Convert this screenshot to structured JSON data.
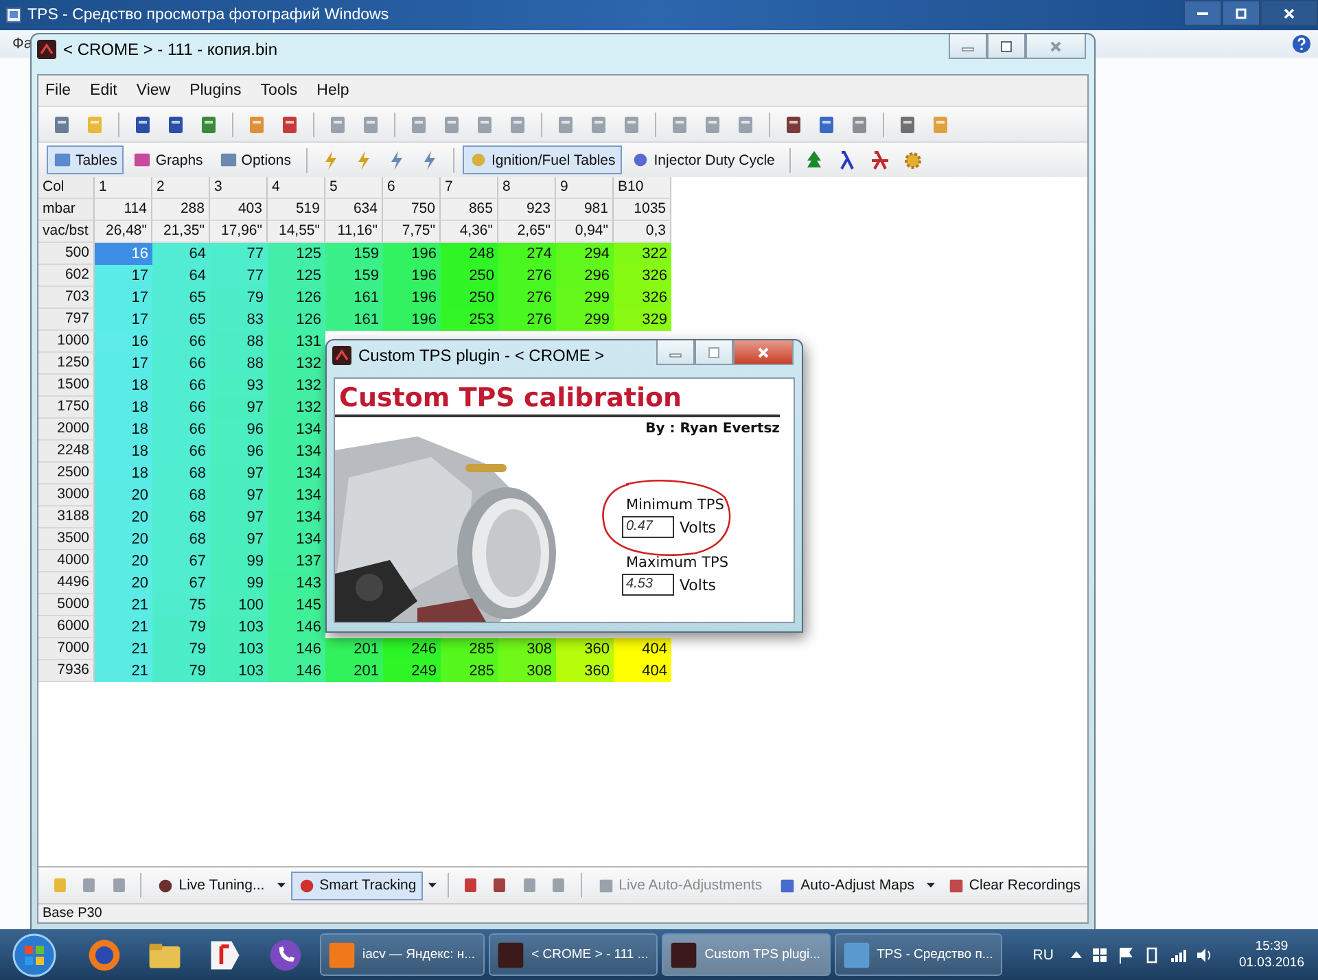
{
  "background_window": {
    "title": "TPS - Средство просмотра фотографий Windows",
    "menu_fragment": "Фа"
  },
  "main_window": {
    "title": "< CROME > - 111 - копия.bin",
    "menu": [
      "File",
      "Edit",
      "View",
      "Plugins",
      "Tools",
      "Help"
    ],
    "toolbar_buttons": [
      {
        "label": "Tables",
        "selected": true
      },
      {
        "label": "Graphs",
        "selected": false
      },
      {
        "label": "Options",
        "selected": false
      },
      {
        "label": "Ignition/Fuel Tables",
        "selected": true
      },
      {
        "label": "Injector Duty Cycle",
        "selected": false
      }
    ],
    "table": {
      "header_rows": [
        {
          "label": "Col",
          "cells": [
            "1",
            "2",
            "3",
            "4",
            "5",
            "6",
            "7",
            "8",
            "9",
            "B10"
          ]
        },
        {
          "label": "mbar",
          "cells": [
            "114",
            "288",
            "403",
            "519",
            "634",
            "750",
            "865",
            "923",
            "981",
            "1035"
          ]
        },
        {
          "label": "vac/bst",
          "cells": [
            "26,48\"",
            "21,35\"",
            "17,96\"",
            "14,55\"",
            "11,16\"",
            "7,75\"",
            "4,36\"",
            "2,65\"",
            "0,94\"",
            "0,3"
          ]
        }
      ],
      "rows": [
        {
          "label": "500",
          "cells": [
            {
              "value": "16",
              "selected": true
            },
            {
              "value": "64",
              "selected": false
            },
            {
              "value": "77",
              "selected": false
            },
            {
              "value": "125",
              "selected": false
            },
            {
              "value": "159",
              "selected": false
            },
            {
              "value": "196",
              "selected": false
            },
            {
              "value": "248",
              "selected": false
            },
            {
              "value": "274",
              "selected": false
            },
            {
              "value": "294",
              "selected": false
            },
            {
              "value": "322",
              "selected": false
            }
          ]
        },
        {
          "label": "602",
          "cells": [
            {
              "value": "17",
              "selected": false
            },
            {
              "value": "64",
              "selected": false
            },
            {
              "value": "77",
              "selected": false
            },
            {
              "value": "125",
              "selected": false
            },
            {
              "value": "159",
              "selected": false
            },
            {
              "value": "196",
              "selected": false
            },
            {
              "value": "250",
              "selected": false
            },
            {
              "value": "276",
              "selected": false
            },
            {
              "value": "296",
              "selected": false
            },
            {
              "value": "326",
              "selected": false
            }
          ]
        },
        {
          "label": "703",
          "cells": [
            {
              "value": "17",
              "selected": false
            },
            {
              "value": "65",
              "selected": false
            },
            {
              "value": "79",
              "selected": false
            },
            {
              "value": "126",
              "selected": false
            },
            {
              "value": "161",
              "selected": false
            },
            {
              "value": "196",
              "selected": false
            },
            {
              "value": "250",
              "selected": false
            },
            {
              "value": "276",
              "selected": false
            },
            {
              "value": "299",
              "selected": false
            },
            {
              "value": "326",
              "selected": false
            }
          ]
        },
        {
          "label": "797",
          "cells": [
            {
              "value": "17",
              "selected": false
            },
            {
              "value": "65",
              "selected": false
            },
            {
              "value": "83",
              "selected": false
            },
            {
              "value": "126",
              "selected": false
            },
            {
              "value": "161",
              "selected": false
            },
            {
              "value": "196",
              "selected": false
            },
            {
              "value": "253",
              "selected": false
            },
            {
              "value": "276",
              "selected": false
            },
            {
              "value": "299",
              "selected": false
            },
            {
              "value": "329",
              "selected": false
            }
          ]
        },
        {
          "label": "1000",
          "cells": [
            {
              "value": "16",
              "selected": false
            },
            {
              "value": "66",
              "selected": false
            },
            {
              "value": "88",
              "selected": false
            },
            {
              "value": "131",
              "selected": false
            }
          ]
        },
        {
          "label": "1250",
          "cells": [
            {
              "value": "17",
              "selected": false
            },
            {
              "value": "66",
              "selected": false
            },
            {
              "value": "88",
              "selected": false
            },
            {
              "value": "132",
              "selected": false
            }
          ]
        },
        {
          "label": "1500",
          "cells": [
            {
              "value": "18",
              "selected": false
            },
            {
              "value": "66",
              "selected": false
            },
            {
              "value": "93",
              "selected": false
            },
            {
              "value": "132",
              "selected": false
            }
          ]
        },
        {
          "label": "1750",
          "cells": [
            {
              "value": "18",
              "selected": false
            },
            {
              "value": "66",
              "selected": false
            },
            {
              "value": "97",
              "selected": false
            },
            {
              "value": "132",
              "selected": false
            }
          ]
        },
        {
          "label": "2000",
          "cells": [
            {
              "value": "18",
              "selected": false
            },
            {
              "value": "66",
              "selected": false
            },
            {
              "value": "96",
              "selected": false
            },
            {
              "value": "134",
              "selected": false
            }
          ]
        },
        {
          "label": "2248",
          "cells": [
            {
              "value": "18",
              "selected": false
            },
            {
              "value": "66",
              "selected": false
            },
            {
              "value": "96",
              "selected": false
            },
            {
              "value": "134",
              "selected": false
            }
          ]
        },
        {
          "label": "2500",
          "cells": [
            {
              "value": "18",
              "selected": false
            },
            {
              "value": "68",
              "selected": false
            },
            {
              "value": "97",
              "selected": false
            },
            {
              "value": "134",
              "selected": false
            }
          ]
        },
        {
          "label": "3000",
          "cells": [
            {
              "value": "20",
              "selected": false
            },
            {
              "value": "68",
              "selected": false
            },
            {
              "value": "97",
              "selected": false
            },
            {
              "value": "134",
              "selected": false
            }
          ]
        },
        {
          "label": "3188",
          "cells": [
            {
              "value": "20",
              "selected": false
            },
            {
              "value": "68",
              "selected": false
            },
            {
              "value": "97",
              "selected": false
            },
            {
              "value": "134",
              "selected": false
            }
          ]
        },
        {
          "label": "3500",
          "cells": [
            {
              "value": "20",
              "selected": false
            },
            {
              "value": "68",
              "selected": false
            },
            {
              "value": "97",
              "selected": false
            },
            {
              "value": "134",
              "selected": false
            }
          ]
        },
        {
          "label": "4000",
          "cells": [
            {
              "value": "20",
              "selected": false
            },
            {
              "value": "67",
              "selected": false
            },
            {
              "value": "99",
              "selected": false
            },
            {
              "value": "137",
              "selected": false
            }
          ]
        },
        {
          "label": "4496",
          "cells": [
            {
              "value": "20",
              "selected": false
            },
            {
              "value": "67",
              "selected": false
            },
            {
              "value": "99",
              "selected": false
            },
            {
              "value": "143",
              "selected": false
            }
          ]
        },
        {
          "label": "5000",
          "cells": [
            {
              "value": "21",
              "selected": false
            },
            {
              "value": "75",
              "selected": false
            },
            {
              "value": "100",
              "selected": false
            },
            {
              "value": "145",
              "selected": false
            }
          ]
        },
        {
          "label": "6000",
          "cells": [
            {
              "value": "21",
              "selected": false
            },
            {
              "value": "79",
              "selected": false
            },
            {
              "value": "103",
              "selected": false
            },
            {
              "value": "146",
              "selected": false
            }
          ]
        },
        {
          "label": "7000",
          "cells": [
            {
              "value": "21",
              "selected": false
            },
            {
              "value": "79",
              "selected": false
            },
            {
              "value": "103",
              "selected": false
            },
            {
              "value": "146",
              "selected": false
            },
            {
              "value": "201",
              "selected": false
            },
            {
              "value": "246",
              "selected": false
            },
            {
              "value": "285",
              "selected": false
            },
            {
              "value": "308",
              "selected": false
            },
            {
              "value": "360",
              "selected": false
            },
            {
              "value": "404",
              "selected": false
            }
          ]
        },
        {
          "label": "7936",
          "cells": [
            {
              "value": "21",
              "selected": false
            },
            {
              "value": "79",
              "selected": false
            },
            {
              "value": "103",
              "selected": false
            },
            {
              "value": "146",
              "selected": false
            },
            {
              "value": "201",
              "selected": false
            },
            {
              "value": "249",
              "selected": false
            },
            {
              "value": "285",
              "selected": false
            },
            {
              "value": "308",
              "selected": false
            },
            {
              "value": "360",
              "selected": false
            },
            {
              "value": "404",
              "selected": false
            }
          ]
        }
      ]
    },
    "bottom_toolbar": [
      {
        "label": "Live Tuning...",
        "selected": false,
        "disabled": false,
        "dropdown": true
      },
      {
        "label": "Smart Tracking",
        "selected": true,
        "disabled": false,
        "dropdown": true
      },
      {
        "label": "Live Auto-Adjustments",
        "selected": false,
        "disabled": true,
        "dropdown": false
      },
      {
        "label": "Auto-Adjust Maps",
        "selected": false,
        "disabled": false,
        "dropdown": true
      },
      {
        "label": "Clear Recordings",
        "selected": false,
        "disabled": false,
        "dropdown": false
      }
    ],
    "status_bar": "Base P30"
  },
  "dialog": {
    "title": "Custom TPS plugin - < CROME >",
    "heading": "Custom TPS calibration",
    "author": "By : Ryan Evertsz",
    "fields": [
      {
        "label": "Minimum TPS",
        "value": "0.47",
        "unit": "Volts",
        "circled": true
      },
      {
        "label": "Maximum TPS",
        "value": "4.53",
        "unit": "Volts",
        "circled": false
      }
    ]
  },
  "taskbar": {
    "tasks": [
      {
        "label": "iacv — Яндекс: н...",
        "selected": false
      },
      {
        "label": "< CROME > - 111 ...",
        "selected": false
      },
      {
        "label": "Custom TPS plugi...",
        "selected": true
      },
      {
        "label": "TPS - Средство п...",
        "selected": false
      }
    ],
    "language": "RU",
    "time": "15:39",
    "date": "01.03.2016"
  }
}
